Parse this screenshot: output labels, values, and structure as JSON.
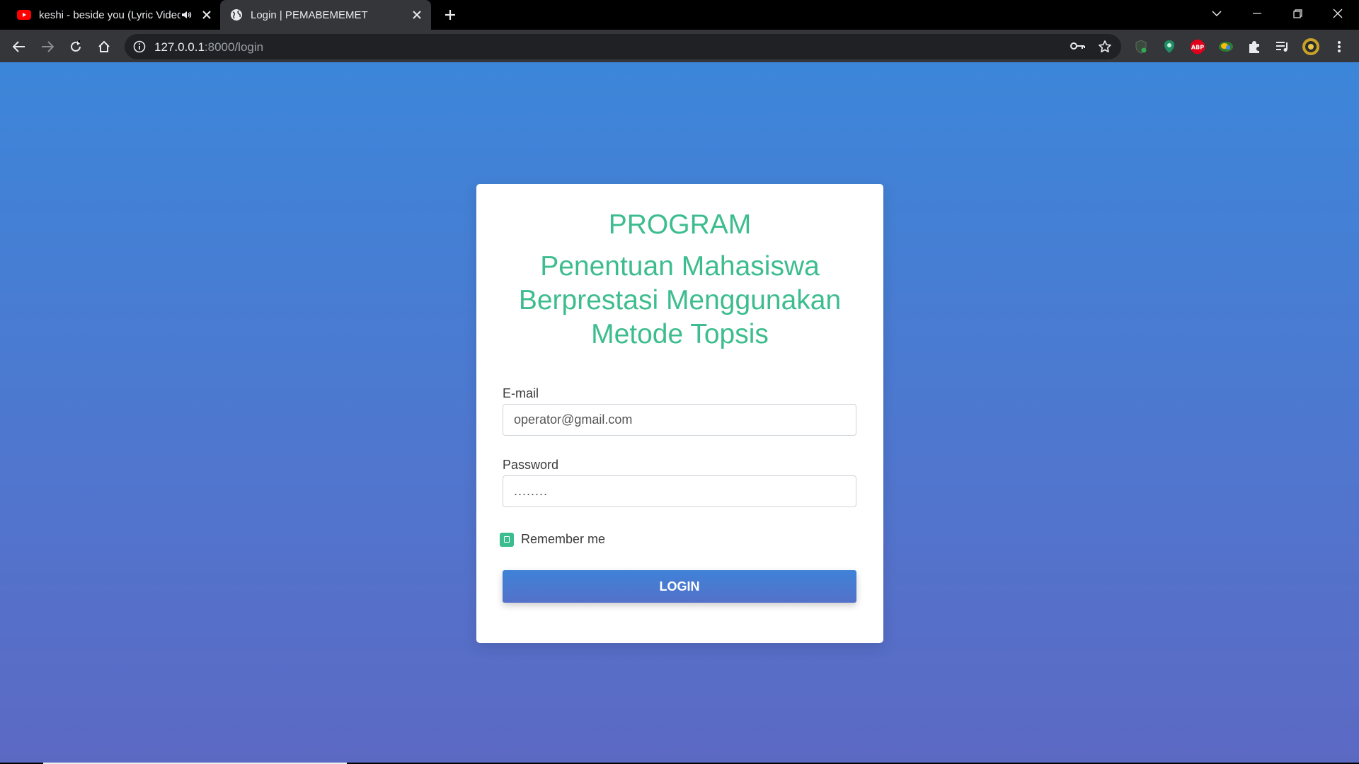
{
  "browser": {
    "tabs": [
      {
        "title": "keshi - beside you (Lyric Video)",
        "favicon": "youtube-icon",
        "audio": "speaker-icon",
        "active": false
      },
      {
        "title": "Login | PEMABEMEMET",
        "favicon": "globe-icon",
        "active": true
      }
    ],
    "new_tab": "+",
    "address": {
      "host": "127.0.0.1",
      "rest": ":8000/login"
    },
    "extensions": [
      "shield-extension-icon",
      "location-extension-icon",
      "ABP",
      "color-extension-icon",
      "puzzle-icon",
      "media-queue-icon",
      "profile-avatar-icon"
    ],
    "colors": {
      "frame": "#000000",
      "toolbar": "#35363a",
      "omnibox": "#202124"
    }
  },
  "page": {
    "title_line1": "PROGRAM",
    "title_line2": "Penentuan Mahasiswa Berprestasi Menggunakan Metode Topsis",
    "email_label": "E-mail",
    "email_value": "operator@gmail.com",
    "password_label": "Password",
    "password_value": "........",
    "remember_label": "Remember me",
    "remember_checked": true,
    "login_label": "LOGIN",
    "colors": {
      "accent": "#3dbd8f",
      "gradient_top": "#3c86d9",
      "gradient_bottom": "#5c69c3",
      "button": "#4a79d0"
    }
  }
}
